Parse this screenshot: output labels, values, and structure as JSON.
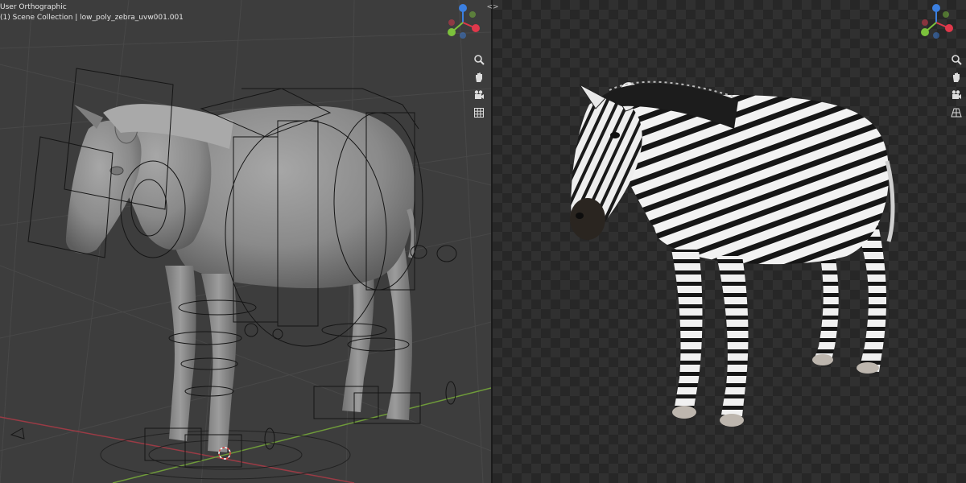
{
  "left_viewport": {
    "view_label": "User Orthographic",
    "collection_label": "(1) Scene Collection | low_poly_zebra_uvw001.001",
    "tool_icons": [
      "zoom-icon",
      "hand-pan-icon",
      "camera-icon",
      "grid-icon"
    ]
  },
  "right_viewport": {
    "tool_icons": [
      "zoom-icon",
      "hand-pan-icon",
      "camera-icon",
      "perspective-grid-icon"
    ]
  },
  "splitter": {
    "arrows": "<>"
  },
  "gizmo": {
    "x_color": "#e0384b",
    "y_color": "#7cc13c",
    "z_color": "#3b7fe0",
    "neg_alpha": 0.5
  },
  "colors": {
    "left_bg": "#3d3d3d",
    "right_bg": "#272727",
    "checker": "#2f2f2f",
    "zebra_white": "#f2f2f2",
    "zebra_black": "#161616",
    "clay": "#8f8f8f"
  }
}
